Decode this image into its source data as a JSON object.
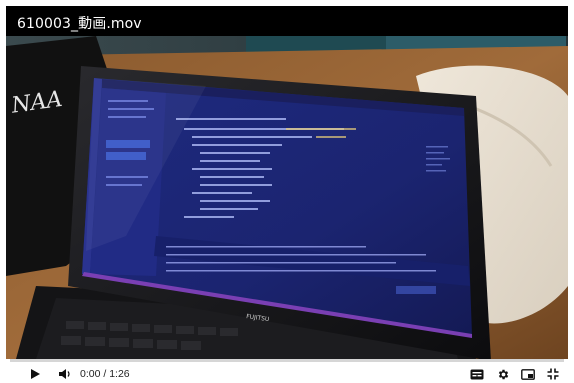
{
  "video": {
    "title": "610003_動画.mov",
    "current_time": "0:00",
    "duration": "1:26",
    "progress": 0
  },
  "controls": {
    "play": "play-icon",
    "volume": "volume-icon",
    "subtitles": "subtitles-icon",
    "settings": "gear-icon",
    "miniplayer": "miniplayer-icon",
    "fullscreen": "fullscreen-icon"
  },
  "colors": {
    "progress_played": "#e02020",
    "progress_track": "#d6d6d6",
    "title_bar": "#000000",
    "control_bar": "#ffffff"
  }
}
